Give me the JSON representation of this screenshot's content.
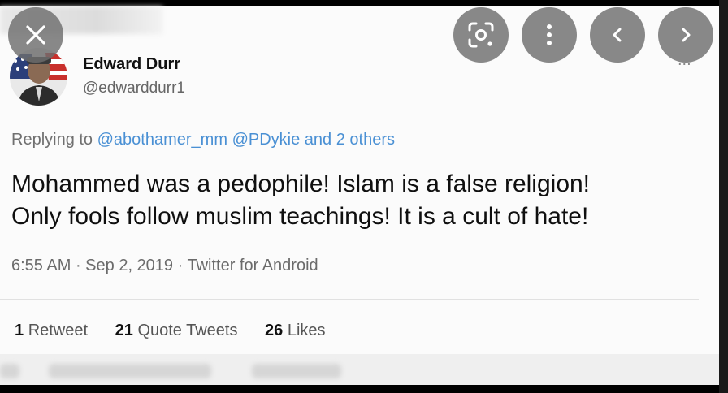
{
  "profile": {
    "name": "Edward Durr",
    "handle": "@edwarddurr1"
  },
  "reply": {
    "prefix": "Replying to ",
    "mention1": "@abothamer_mm",
    "mention2": "@PDykie",
    "suffix": "and 2 others"
  },
  "tweet": {
    "line1": "Mohammed was a pedophile! Islam is a false religion!",
    "line2": "Only fools follow muslim teachings! It is a cult of hate!"
  },
  "meta": {
    "time": "6:55 AM",
    "date": "Sep 2, 2019",
    "source": "Twitter for Android"
  },
  "stats": {
    "retweets_count": "1",
    "retweets_label": "Retweet",
    "quotes_count": "21",
    "quotes_label": "Quote Tweets",
    "likes_count": "26",
    "likes_label": "Likes"
  },
  "more_label": "...",
  "icons": {
    "close": "close-icon",
    "lens": "lens-icon",
    "more": "more-vertical-icon",
    "prev": "chevron-left-icon",
    "next": "chevron-right-icon"
  },
  "colors": {
    "link": "#4a90d4",
    "overlay_button": "#6e6e6e"
  }
}
